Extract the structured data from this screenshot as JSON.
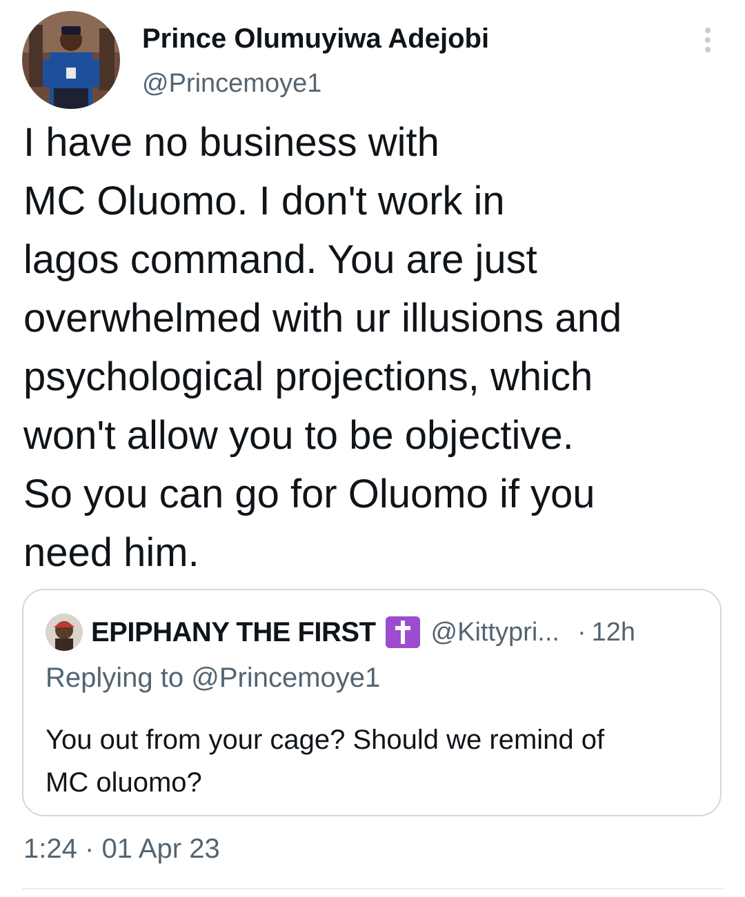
{
  "tweet": {
    "author": {
      "name": "Prince Olumuyiwa Adejobi",
      "handle": "@Princemoye1"
    },
    "text_lines": [
      "I have no business with",
      "MC Oluomo. I don't work in",
      "lagos command. You are just",
      "overwhelmed with ur illusions and",
      "psychological projections, which",
      "won't allow you to be objective.",
      "So you can go for Oluomo if you",
      "need him."
    ],
    "time": "1:24",
    "separator": "·",
    "date": "01 Apr 23"
  },
  "quoted_tweet": {
    "author": {
      "name": "EPIPHANY THE FIRST",
      "handle": "@Kittypri..."
    },
    "separator": "·",
    "time_ago": "12h",
    "reply_prefix": "Replying to",
    "reply_mention": "@Princemoye1",
    "text_lines": [
      "You out from your cage? Should we remind of",
      "MC oluomo?"
    ]
  },
  "icons": {
    "more": "more-vertical-icon",
    "badge": "latin-cross-emoji-icon"
  },
  "colors": {
    "text_primary": "#0f1419",
    "text_secondary": "#536471",
    "border": "#cfd9de",
    "badge_purple": "#9b4ccf"
  }
}
